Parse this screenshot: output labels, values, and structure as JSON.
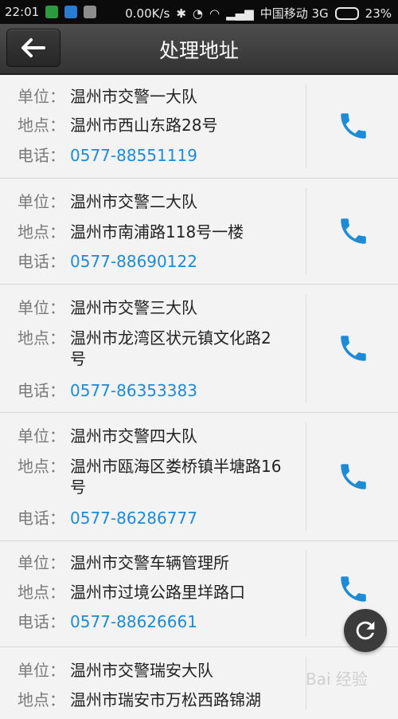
{
  "status": {
    "time": "22:01",
    "speed": "0.00K/s",
    "carrier": "中国移动 3G",
    "battery": "23%"
  },
  "header": {
    "title": "处理地址",
    "back_icon": "left-arrow-icon"
  },
  "labels": {
    "unit": "单位：",
    "address": "地点：",
    "phone": "电话："
  },
  "items": [
    {
      "unit": "温州市交警一大队",
      "address": "温州市西山东路28号",
      "phone": "0577-88551119"
    },
    {
      "unit": "温州市交警二大队",
      "address": "温州市南浦路118号一楼",
      "phone": "0577-88690122"
    },
    {
      "unit": "温州市交警三大队",
      "address": "温州市龙湾区状元镇文化路2号",
      "phone": "0577-86353383"
    },
    {
      "unit": "温州市交警四大队",
      "address": "温州市瓯海区娄桥镇半塘路16号",
      "phone": "0577-86286777"
    },
    {
      "unit": "温州市交警车辆管理所",
      "address": "温州市过境公路里垟路口",
      "phone": "0577-88626661"
    },
    {
      "unit": "温州市交警瑞安大队",
      "address": "温州市瑞安市万松西路锦湖"
    }
  ],
  "colors": {
    "accent": "#1e8bd6",
    "header_bg": "#3c3c3c",
    "list_bg": "#f3f3f3"
  },
  "icons": {
    "call": "phone-icon",
    "refresh": "refresh-icon"
  },
  "watermark": "Bai 经验"
}
